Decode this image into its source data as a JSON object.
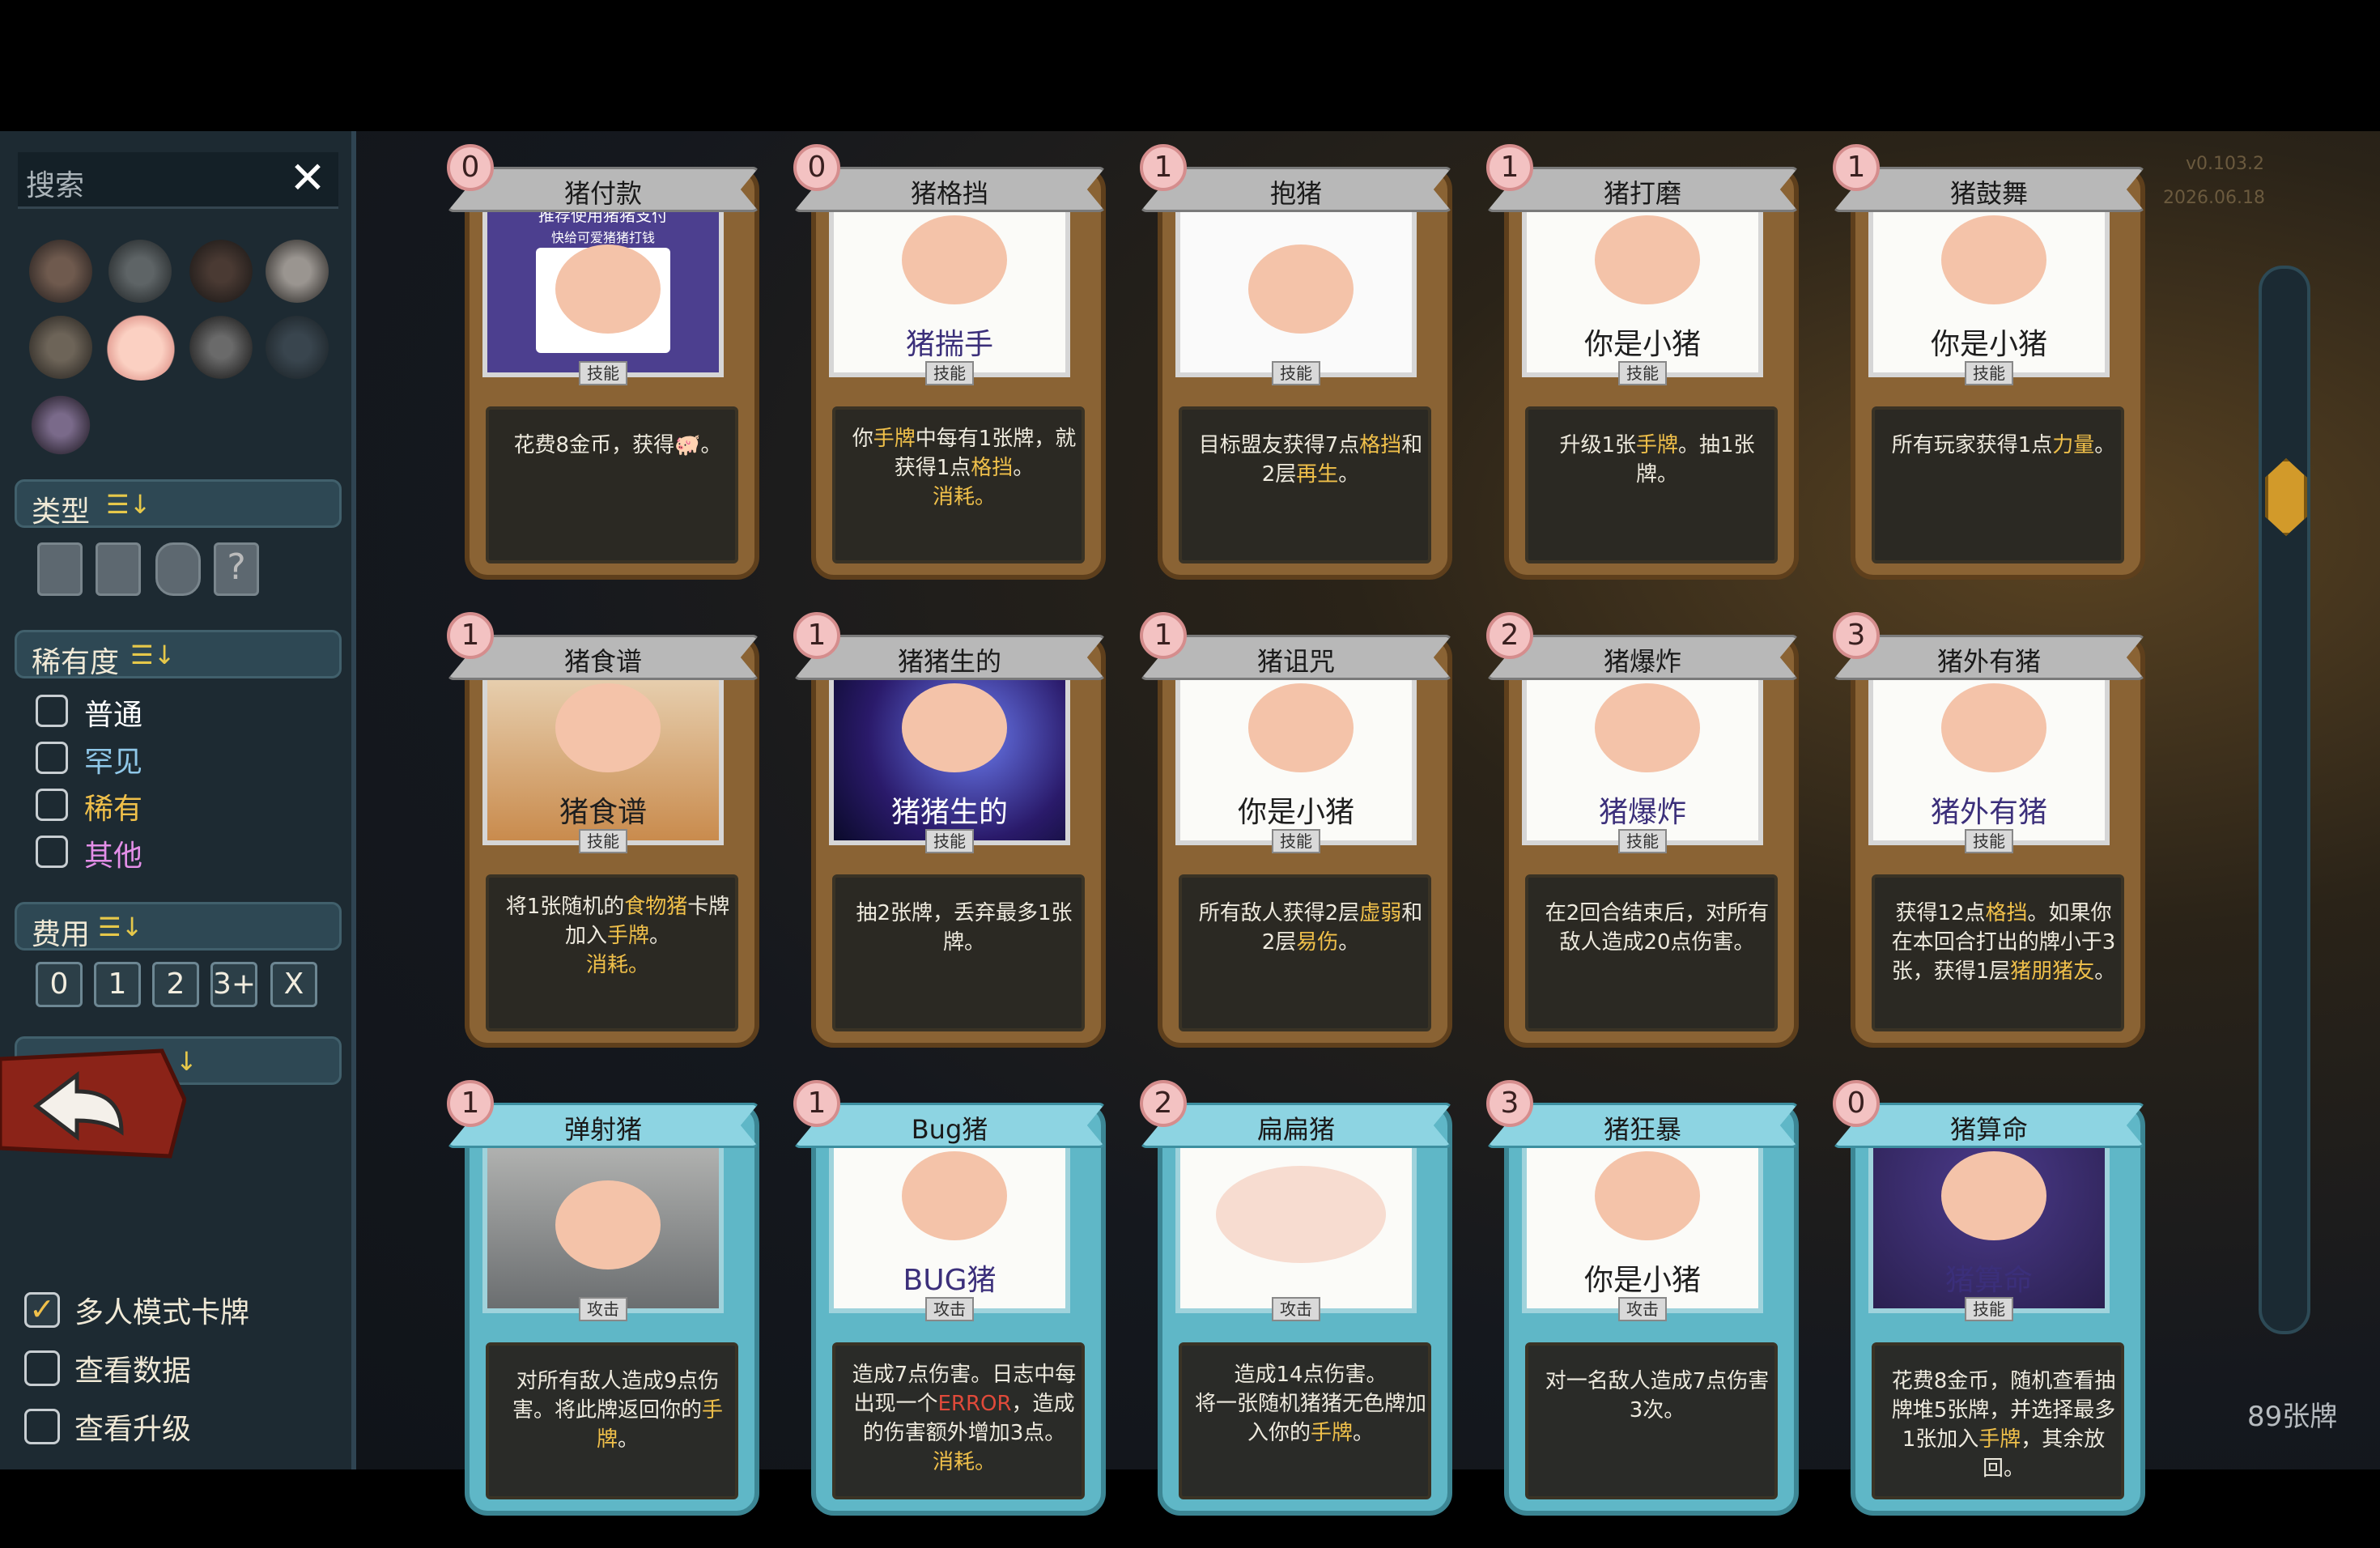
{
  "sidebar": {
    "search_label": "搜索",
    "close_icon": "close-icon",
    "character_icons": [
      "red-claw-icon",
      "beast-skull-icon",
      "star-dagger-icon",
      "skull-icon",
      "paw-icon",
      "pig-icon",
      "orb-icon",
      "dark-creature-icon",
      "crystal-icon"
    ],
    "type_header": "类型",
    "rarity_header": "稀有度",
    "rarity": [
      {
        "label": "普通",
        "color": "#ffffff"
      },
      {
        "label": "罕见",
        "color": "#8fc7e8"
      },
      {
        "label": "稀有",
        "color": "#f0c04a"
      },
      {
        "label": "其他",
        "color": "#e48fe8"
      }
    ],
    "cost_header": "费用",
    "costs": [
      "0",
      "1",
      "2",
      "3+",
      "X"
    ],
    "bottom": [
      {
        "label": "多人模式卡牌",
        "checked": true
      },
      {
        "label": "查看数据",
        "checked": false
      },
      {
        "label": "查看升级",
        "checked": false
      }
    ]
  },
  "card_count": "89张牌",
  "cards": [
    {
      "cost": "0",
      "name": "猪付款",
      "type": "技能",
      "kind": "skill",
      "art_caption": "",
      "art_top": "推荐使用猪猪支付",
      "art_sub": "快给可爱猪猪打钱",
      "desc": [
        "花费8金币，获得🐖。"
      ]
    },
    {
      "cost": "0",
      "name": "猪格挡",
      "type": "技能",
      "kind": "skill",
      "art_caption": "猪揣手",
      "desc": [
        "你手牌中每有1张牌，就获得1点格挡。",
        "消耗。"
      ]
    },
    {
      "cost": "1",
      "name": "抱猪",
      "type": "技能",
      "kind": "skill",
      "art_caption": "",
      "desc": [
        "目标盟友获得7点格挡和2层再生。"
      ]
    },
    {
      "cost": "1",
      "name": "猪打磨",
      "type": "技能",
      "kind": "skill",
      "art_caption": "你是小猪",
      "desc": [
        "升级1张手牌。抽1张牌。"
      ]
    },
    {
      "cost": "1",
      "name": "猪鼓舞",
      "type": "技能",
      "kind": "skill",
      "art_caption": "你是小猪",
      "desc": [
        "所有玩家获得1点力量。"
      ]
    },
    {
      "cost": "1",
      "name": "猪食谱",
      "type": "技能",
      "kind": "skill",
      "art_caption": "猪食谱",
      "desc": [
        "将1张随机的食物猪卡牌加入手牌。",
        "消耗。"
      ]
    },
    {
      "cost": "1",
      "name": "猪猪生的",
      "type": "技能",
      "kind": "skill",
      "art_caption": "猪猪生的",
      "desc": [
        "抽2张牌，丢弃最多1张牌。"
      ]
    },
    {
      "cost": "1",
      "name": "猪诅咒",
      "type": "技能",
      "kind": "skill",
      "art_caption": "你是小猪",
      "desc": [
        "所有敌人获得2层虚弱和2层易伤。"
      ]
    },
    {
      "cost": "2",
      "name": "猪爆炸",
      "type": "技能",
      "kind": "skill",
      "art_caption": "猪爆炸",
      "desc": [
        "在2回合结束后，对所有敌人造成20点伤害。"
      ]
    },
    {
      "cost": "3",
      "name": "猪外有猪",
      "type": "技能",
      "kind": "skill",
      "art_caption": "猪外有猪",
      "desc": [
        "获得12点格挡。如果你在本回合打出的牌小于3张，获得1层猪朋猪友。"
      ]
    },
    {
      "cost": "1",
      "name": "弹射猪",
      "type": "攻击",
      "kind": "attack",
      "art_caption": "",
      "desc": [
        "对所有敌人造成9点伤害。将此牌返回你的手牌。"
      ]
    },
    {
      "cost": "1",
      "name": "Bug猪",
      "type": "攻击",
      "kind": "attack",
      "art_caption": "BUG猪",
      "desc": [
        "造成7点伤害。日志中每出现一个ERROR，造成的伤害额外增加3点。",
        "消耗。"
      ]
    },
    {
      "cost": "2",
      "name": "扁扁猪",
      "type": "攻击",
      "kind": "attack",
      "art_caption": "",
      "desc": [
        "造成14点伤害。",
        "将一张随机猪猪无色牌加入你的手牌。"
      ]
    },
    {
      "cost": "3",
      "name": "猪狂暴",
      "type": "攻击",
      "kind": "attack",
      "art_caption": "你是小猪",
      "desc": [
        "对一名敌人造成7点伤害3次。"
      ]
    },
    {
      "cost": "0",
      "name": "猪算命",
      "type": "技能",
      "kind": "attack",
      "art_caption": "猪算命",
      "desc": [
        "花费8金币，随机查看抽牌堆5张牌，并选择最多1张加入手牌，其余放回。"
      ]
    }
  ],
  "stamp": [
    "v0.103.2",
    "2026.06.18"
  ]
}
